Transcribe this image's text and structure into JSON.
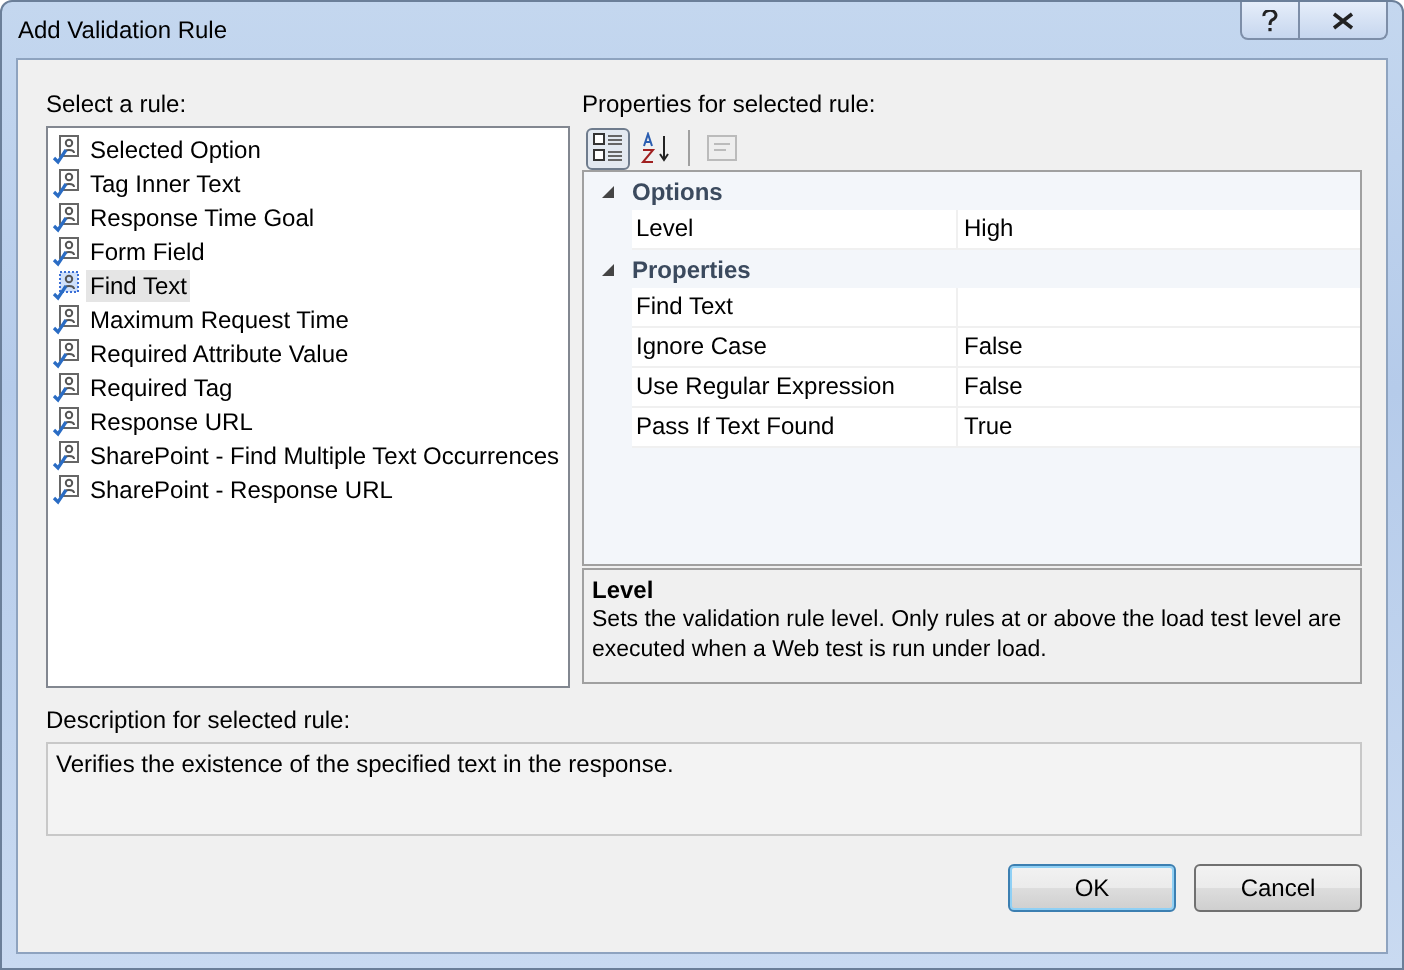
{
  "window": {
    "title": "Add Validation Rule"
  },
  "rules": {
    "label": "Select a rule:",
    "items": [
      {
        "label": "Selected Option",
        "selected": false
      },
      {
        "label": "Tag Inner Text",
        "selected": false
      },
      {
        "label": "Response Time Goal",
        "selected": false
      },
      {
        "label": "Form Field",
        "selected": false
      },
      {
        "label": "Find Text",
        "selected": true
      },
      {
        "label": "Maximum Request Time",
        "selected": false
      },
      {
        "label": "Required Attribute Value",
        "selected": false
      },
      {
        "label": "Required Tag",
        "selected": false
      },
      {
        "label": "Response URL",
        "selected": false
      },
      {
        "label": "SharePoint - Find Multiple Text Occurrences",
        "selected": false
      },
      {
        "label": "SharePoint - Response URL",
        "selected": false
      }
    ]
  },
  "properties": {
    "label": "Properties for selected rule:",
    "toolbar": [
      {
        "kind": "categorized",
        "selected": true,
        "disabled": false
      },
      {
        "kind": "alphabetical",
        "selected": false,
        "disabled": false
      },
      {
        "kind": "pages",
        "selected": false,
        "disabled": true
      }
    ],
    "categories": [
      {
        "name": "Options",
        "expanded": true,
        "rows": [
          {
            "name": "Level",
            "value": "High"
          }
        ]
      },
      {
        "name": "Properties",
        "expanded": true,
        "rows": [
          {
            "name": "Find Text"
          },
          {
            "name": "Ignore Case",
            "value": "False"
          },
          {
            "name": "Use Regular Expression",
            "value": "False"
          },
          {
            "name": "Pass If Text Found",
            "value": "True"
          }
        ]
      }
    ],
    "help": {
      "title": "Level",
      "text": "Sets the validation rule level.  Only rules at or above the load test level are executed when a Web test is run under load."
    }
  },
  "description": {
    "label": "Description for selected rule:",
    "text": "Verifies the existence of the specified text in the response."
  },
  "buttons": [
    {
      "label": "OK",
      "default": true
    },
    {
      "label": "Cancel",
      "default": false
    }
  ]
}
